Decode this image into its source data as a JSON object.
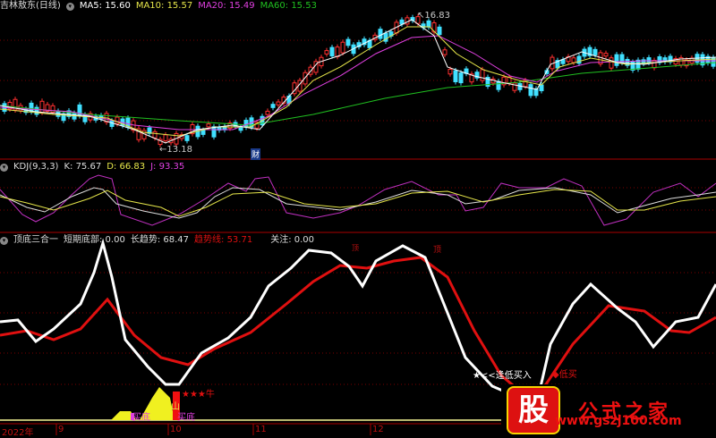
{
  "main": {
    "title": "吉林敖东(日线)",
    "ma5": "MA5: 15.60",
    "ma10": "MA10: 15.57",
    "ma20": "MA20: 15.49",
    "ma60": "MA60: 15.53",
    "high_label": "16.83",
    "low_label": "13.18",
    "cai": "财"
  },
  "kdj": {
    "title": "KDJ(9,3,3)",
    "k": "K: 75.67",
    "d": "D: 66.83",
    "j": "J: 93.35"
  },
  "ind": {
    "title": "顶底三合一",
    "short": "短期底部: 0.00",
    "long": "长趋势: 68.47",
    "trend": "趋势线: 53.71",
    "focus": "关注: 0.00",
    "top1": "顶",
    "top2": "顶",
    "buy_low": "逢低买入",
    "low_buy": "低买",
    "niu": "★★★牛",
    "shan": "山",
    "buy_bottom1": "买底",
    "buy_bottom2": "买底"
  },
  "axis": {
    "labels": [
      "2022年",
      "9",
      "10",
      "11",
      "12"
    ]
  },
  "watermark": {
    "logo": "股",
    "text": "公式之家",
    "url": "www.gszj100.com"
  },
  "colors": {
    "ma5": "#ffffff",
    "ma10": "#e6e64a",
    "ma20": "#e040e0",
    "ma60": "#20c020",
    "up": "#ff3030",
    "down": "#40e0ff"
  }
}
